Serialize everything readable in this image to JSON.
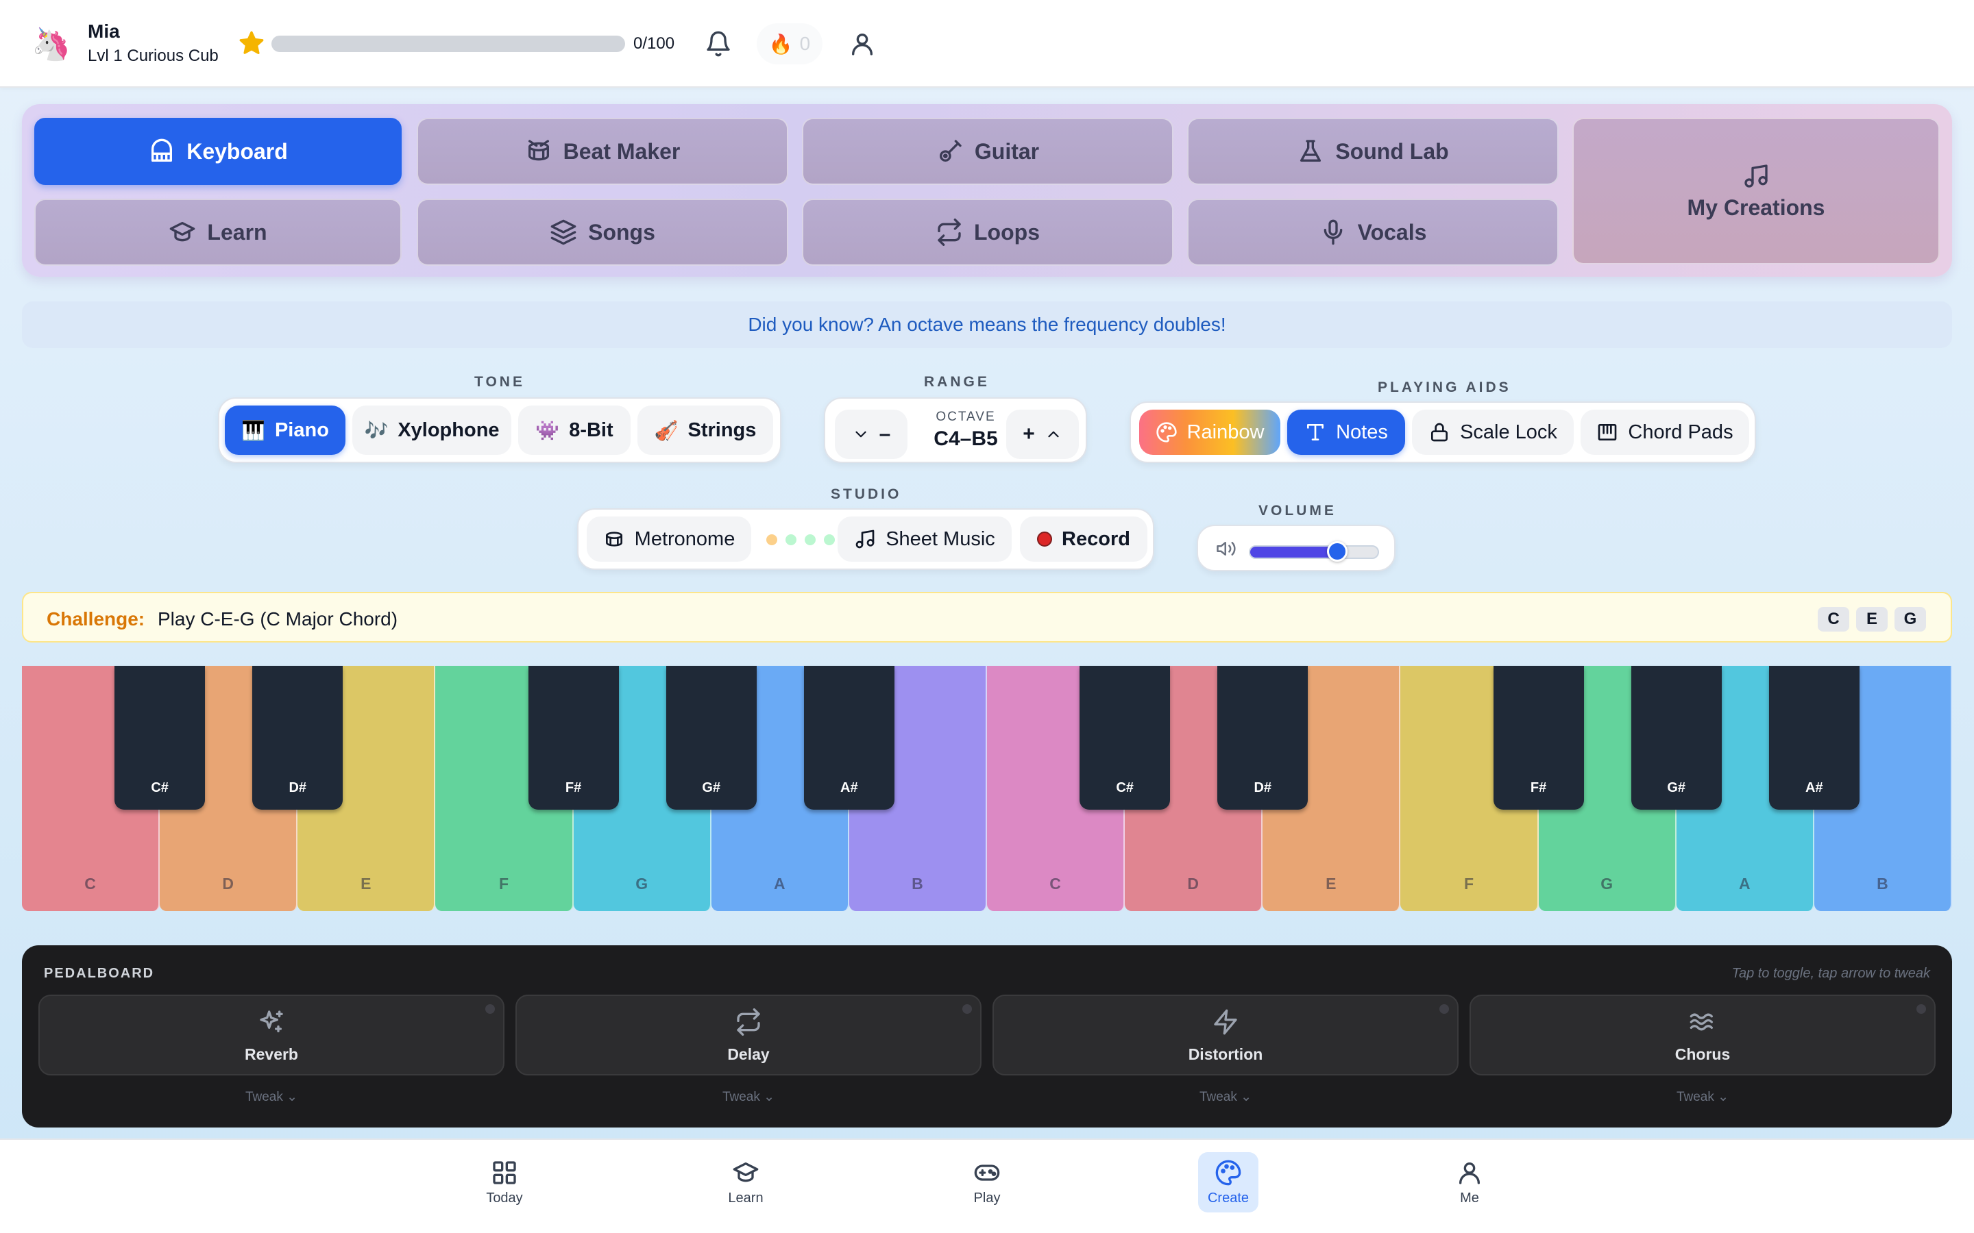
{
  "user": {
    "name": "Mia",
    "level": "Lvl 1 Curious Cub",
    "xp_text": "0/100",
    "xp_progress": 0,
    "streak": "0"
  },
  "modes": [
    {
      "label": "Keyboard",
      "icon": "piano-icon",
      "active": true
    },
    {
      "label": "Beat Maker",
      "icon": "drum-icon"
    },
    {
      "label": "Guitar",
      "icon": "guitar-icon"
    },
    {
      "label": "Sound Lab",
      "icon": "flask-icon"
    },
    {
      "label": "My Creations",
      "icon": "music-note-icon"
    },
    {
      "label": "Learn",
      "icon": "graduation-cap-icon"
    },
    {
      "label": "Songs",
      "icon": "layers-icon"
    },
    {
      "label": "Loops",
      "icon": "repeat-icon"
    },
    {
      "label": "Vocals",
      "icon": "microphone-icon"
    }
  ],
  "tip": "Did you know? An octave means the frequency doubles!",
  "tone": {
    "label": "TONE",
    "options": [
      {
        "label": "Piano",
        "icon": "🎹",
        "active": true
      },
      {
        "label": "Xylophone",
        "icon": "🎶"
      },
      {
        "label": "8-Bit",
        "icon": "👾"
      },
      {
        "label": "Strings",
        "icon": "🎻"
      }
    ]
  },
  "range": {
    "label": "RANGE",
    "octave_label": "OCTAVE",
    "value": "C4–B5",
    "down_label": "–",
    "up_label": "+"
  },
  "aids": {
    "label": "PLAYING AIDS",
    "options": [
      {
        "label": "Rainbow",
        "icon": "palette-icon"
      },
      {
        "label": "Notes",
        "icon": "text-icon",
        "active": true
      },
      {
        "label": "Scale Lock",
        "icon": "lock-icon"
      },
      {
        "label": "Chord Pads",
        "icon": "piano-icon"
      }
    ]
  },
  "studio": {
    "label": "STUDIO",
    "metronome": "Metronome",
    "sheet_music": "Sheet Music",
    "record": "Record"
  },
  "volume": {
    "label": "VOLUME",
    "value": 0.68
  },
  "challenge": {
    "label": "Challenge:",
    "text": "Play C-E-G (C Major Chord)",
    "notes": [
      "C",
      "E",
      "G"
    ]
  },
  "keyboard": {
    "white_keys": [
      "C",
      "D",
      "E",
      "F",
      "G",
      "A",
      "B",
      "C",
      "D",
      "E",
      "F",
      "G",
      "A",
      "B"
    ],
    "white_colors": [
      "#e4858f",
      "#e8a574",
      "#dcc765",
      "#63d39c",
      "#52c7de",
      "#6aaaf5",
      "#9d90f0",
      "#dc89c4",
      "#e08591",
      "#e8a574",
      "#dcc765",
      "#63d39c",
      "#52c7de",
      "#6aaaf5"
    ],
    "black_keys": [
      "C#",
      "D#",
      "F#",
      "G#",
      "A#",
      "C#",
      "D#",
      "F#",
      "G#",
      "A#"
    ]
  },
  "pedalboard": {
    "title": "PEDALBOARD",
    "hint": "Tap to toggle, tap arrow to tweak",
    "pedals": [
      {
        "name": "Reverb",
        "icon": "sparkles-icon",
        "tweak": "Tweak ⌄"
      },
      {
        "name": "Delay",
        "icon": "repeat-icon",
        "tweak": "Tweak ⌄"
      },
      {
        "name": "Distortion",
        "icon": "lightning-icon",
        "tweak": "Tweak ⌄"
      },
      {
        "name": "Chorus",
        "icon": "waves-icon",
        "tweak": "Tweak ⌄"
      }
    ]
  },
  "nav": [
    {
      "label": "Today",
      "icon": "grid-icon"
    },
    {
      "label": "Learn",
      "icon": "graduation-cap-icon"
    },
    {
      "label": "Play",
      "icon": "gamepad-icon"
    },
    {
      "label": "Create",
      "icon": "palette-icon",
      "active": true
    },
    {
      "label": "Me",
      "icon": "user-icon"
    }
  ]
}
